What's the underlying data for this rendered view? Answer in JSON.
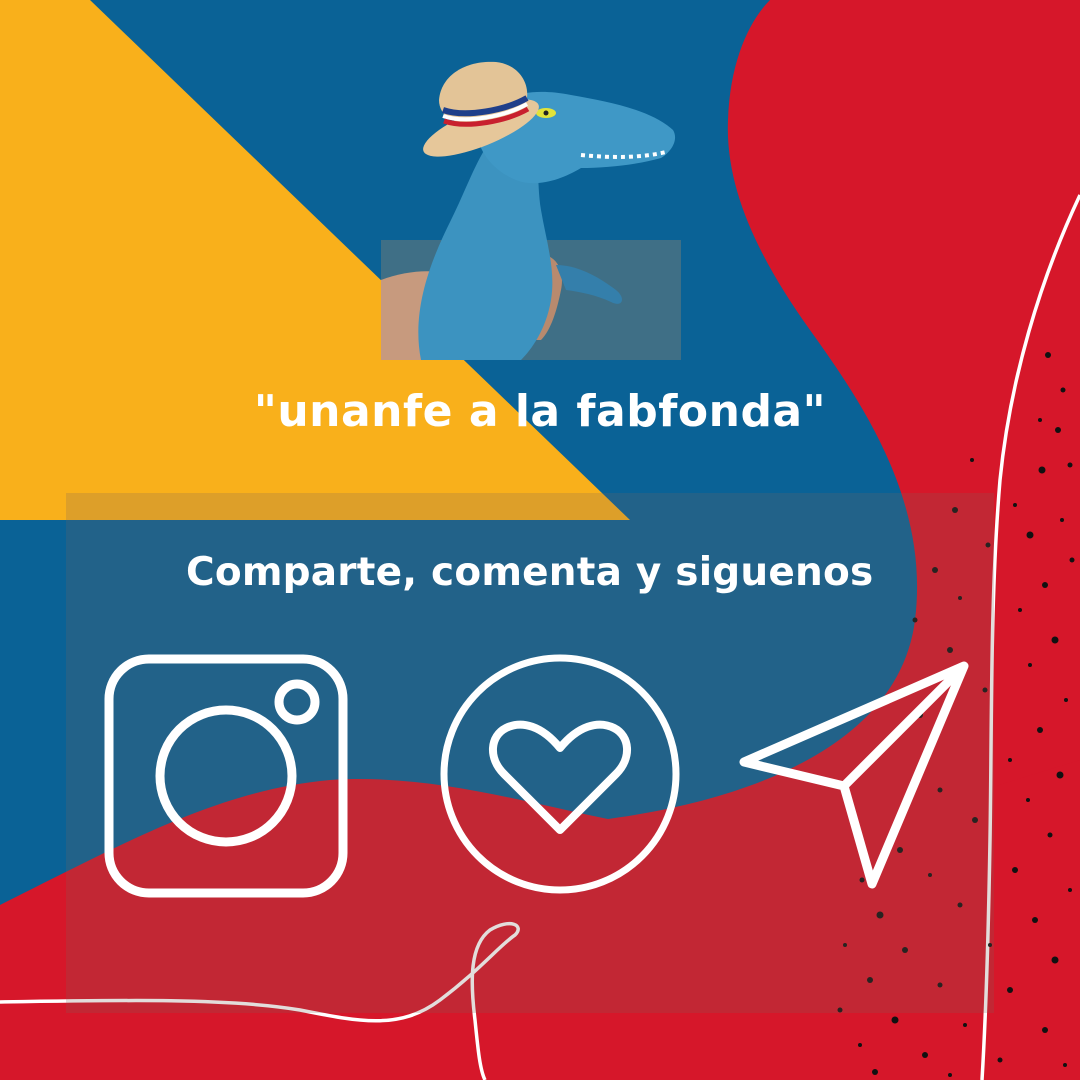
{
  "post": {
    "quote": "\"unanfe a la fabfonda\"",
    "call_to_action": "Comparte, comenta y siguenos"
  },
  "colors": {
    "yellow": "#F9B01B",
    "blue": "#0A6296",
    "red": "#D6172A",
    "white": "#FFFFFF"
  },
  "icons": [
    "instagram-icon",
    "heart-icon",
    "send-icon"
  ],
  "image": {
    "subject": "blue toy dinosaur wearing a straw hat"
  }
}
